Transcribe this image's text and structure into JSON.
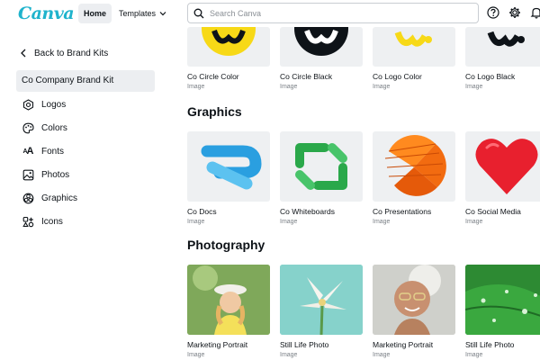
{
  "header": {
    "logo": "Canva",
    "nav_home": "Home",
    "nav_templates": "Templates",
    "search_placeholder": "Search Canva"
  },
  "sidebar": {
    "back_label": "Back to Brand Kits",
    "kit_title": "Co Company Brand Kit",
    "items": [
      {
        "label": "Logos",
        "icon": "logos-icon"
      },
      {
        "label": "Colors",
        "icon": "palette-icon"
      },
      {
        "label": "Fonts",
        "icon": "fonts-icon"
      },
      {
        "label": "Photos",
        "icon": "photos-icon"
      },
      {
        "label": "Graphics",
        "icon": "graphics-icon"
      },
      {
        "label": "Icons",
        "icon": "icons-icon"
      }
    ]
  },
  "logos": [
    {
      "name": "Co Circle Color",
      "type": "Image"
    },
    {
      "name": "Co Circle Black",
      "type": "Image"
    },
    {
      "name": "Co Logo Color",
      "type": "Image"
    },
    {
      "name": "Co Logo Black",
      "type": "Image"
    }
  ],
  "graphics": {
    "title": "Graphics",
    "items": [
      {
        "name": "Co Docs",
        "type": "Image"
      },
      {
        "name": "Co Whiteboards",
        "type": "Image"
      },
      {
        "name": "Co Presentations",
        "type": "Image"
      },
      {
        "name": "Co Social Media",
        "type": "Image"
      }
    ]
  },
  "photography": {
    "title": "Photography",
    "items": [
      {
        "name": "Marketing Portrait",
        "type": "Image"
      },
      {
        "name": "Still Life Photo",
        "type": "Image"
      },
      {
        "name": "Marketing Portrait",
        "type": "Image"
      },
      {
        "name": "Still Life Photo",
        "type": "Image"
      }
    ]
  },
  "colors": {
    "brand_teal": "#1fb3cc",
    "brand_purple": "#7d2ae8",
    "logo_yellow": "#f7d917"
  }
}
